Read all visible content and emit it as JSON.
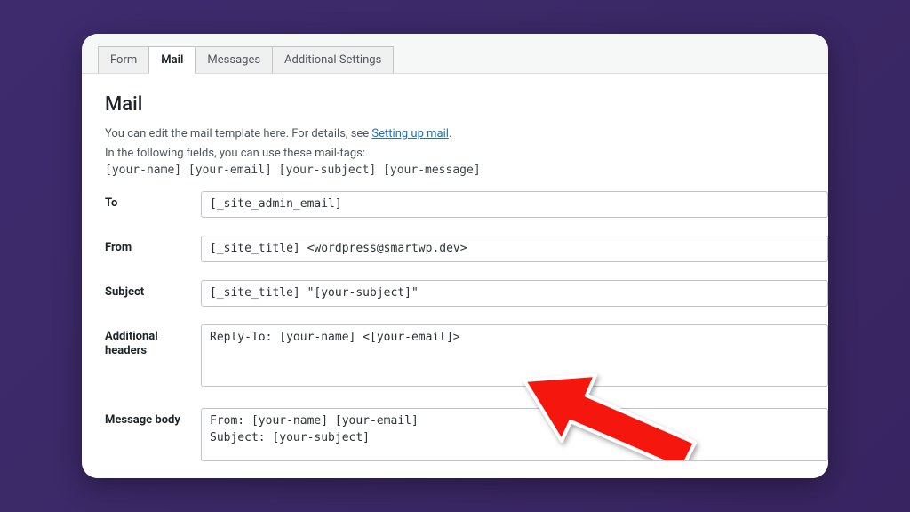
{
  "tabs": {
    "form": "Form",
    "mail": "Mail",
    "messages": "Messages",
    "additional": "Additional Settings"
  },
  "section": {
    "heading": "Mail",
    "intro_prefix": "You can edit the mail template here. For details, see ",
    "intro_link": "Setting up mail",
    "intro_suffix": ".",
    "tags_line": "In the following fields, you can use these mail-tags:",
    "tags_code": "[your-name] [your-email] [your-subject] [your-message]"
  },
  "fields": {
    "to": {
      "label": "To",
      "value": "[_site_admin_email]"
    },
    "from": {
      "label": "From",
      "value": "[_site_title] <wordpress@smartwp.dev>"
    },
    "subject": {
      "label": "Subject",
      "value": "[_site_title] \"[your-subject]\""
    },
    "headers": {
      "label": "Additional headers",
      "value": "Reply-To: [your-name] <[your-email]>"
    },
    "body": {
      "label": "Message body",
      "value": "From: [your-name] [your-email]\nSubject: [your-subject]"
    }
  }
}
